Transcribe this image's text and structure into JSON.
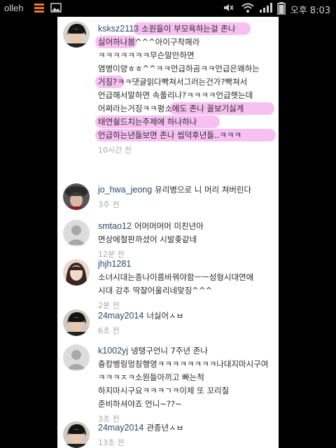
{
  "statusbar": {
    "carrier": "olleh",
    "ampm": "오후",
    "time": "8:03"
  },
  "comments": [
    {
      "username": "ksksz2113",
      "lines": [
        "소원들이 부모욕하는걸 존나",
        "싫어하나봄^^^아이구착해라",
        "ㅋㅋㅋㅋㅋㅋㅋ무슨말만하면",
        "염병이양ㅎㅎ^^ㅋㅋ언급하곰ㅋㅋ언급은왜하는",
        "거징?ㅋㅋ댓글읽다빡쳐서그러는건가?빡쳐서",
        "언급해서말하면 속풀리나?ㅋㅋㅋㅋ언급햇는데",
        "어쩌라는거징ㅋㅋ평소에도 존나 꼴보기싫게",
        "태연쉴드치는주제에 하나하나",
        "언급하는년들보면 존나 씹덕후년들..ㅋㅋㅋ"
      ],
      "time": "10시간 전",
      "avatar": "male-dark-hair"
    },
    {
      "username": "jo_hwa_jeong",
      "lines": [
        "유리병으로 니 머리 쳐버린다"
      ],
      "time": "3주 전",
      "avatar": "girl-hat"
    },
    {
      "username": "smtao12",
      "lines": [
        "어머머머머 미친년아",
        "면상에철판까셨어 시발좆같네"
      ],
      "time": "12분 전",
      "avatar": "default-person"
    },
    {
      "username": "jhjh1281",
      "lines": [
        "소녀시대는종나이름바꿔야함ㅡㅡ성형시대연애",
        "시대 강추 딱잘어울리네맞징^^^"
      ],
      "time": "2분 전",
      "avatar": "girl-selfie"
    },
    {
      "username": "24may2014",
      "lines": [
        "너싫어ㅅㅂ"
      ],
      "time": "6초 전",
      "avatar": "male-dark-hair"
    },
    {
      "username": "k1002yj",
      "lines": [
        "넹탱구언니 7주년 존나",
        "츙캉벵링멍칭행영ㅋㅋㅋㅋㅋㅋㅋㅋ나대지마시구여",
        "ㅋㅋㅋㅈㅋ소원들아끼고 빠는척",
        "하지마시구요ㅋㅋㅋㄱㅋ이제 또 꼬리칠",
        "준비하셔야죠 언니~??~"
      ],
      "time": "3초 전",
      "avatar": "default-person"
    },
    {
      "username": "24may2014",
      "lines": [
        "관종년ㅅㅂ"
      ],
      "time": "13초 전",
      "avatar": "male-dark-hair"
    }
  ]
}
